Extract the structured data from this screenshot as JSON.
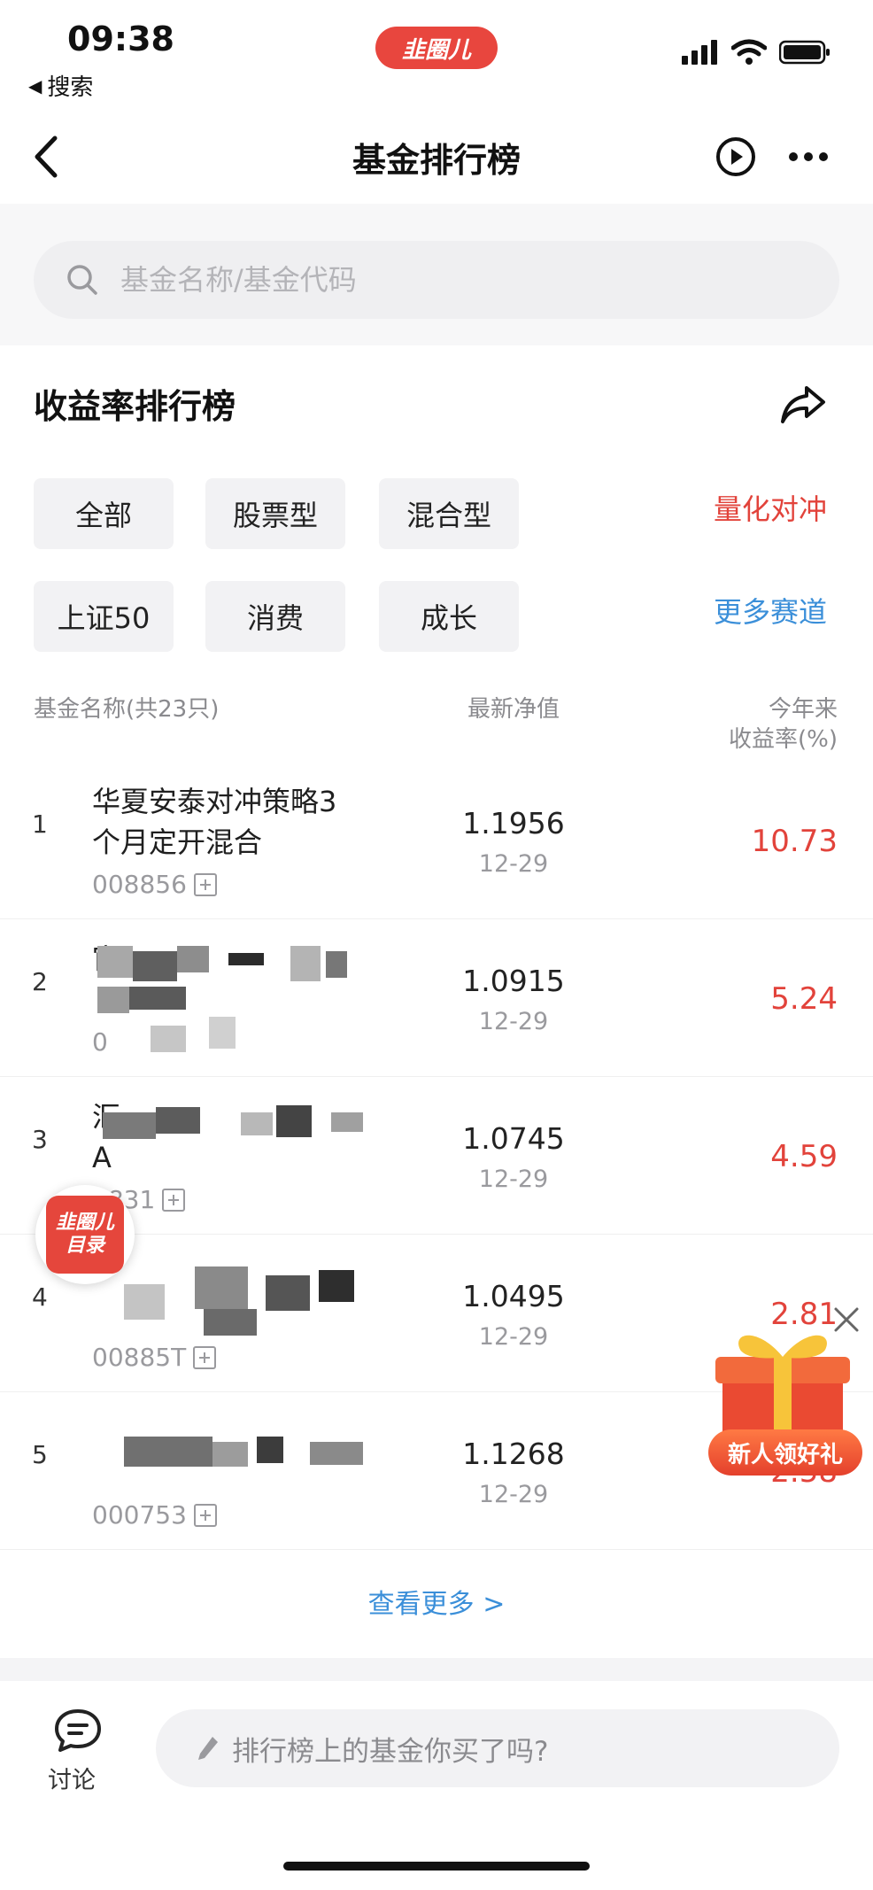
{
  "status_bar": {
    "time": "09:38",
    "back_label": "搜索",
    "brand": "韭圈儿"
  },
  "nav": {
    "title": "基金排行榜"
  },
  "search": {
    "placeholder": "基金名称/基金代码"
  },
  "section": {
    "title": "收益率排行榜"
  },
  "filters": {
    "row1": [
      "全部",
      "股票型",
      "混合型"
    ],
    "row1_link": "量化对冲",
    "row2": [
      "上证50",
      "消费",
      "成长"
    ],
    "row2_link": "更多赛道",
    "active_link_color": "#e2433b",
    "more_link_color": "#3b8fd9"
  },
  "table": {
    "col_name": "基金名称(共23只)",
    "col_nav": "最新净值",
    "col_return_line1": "今年来",
    "col_return_line2": "收益率(%)",
    "rows": [
      {
        "rank": "1",
        "name_line1": "华夏安泰对冲策略3",
        "name_line2": "个月定开混合",
        "code": "008856",
        "nav": "1.1956",
        "date": "12-29",
        "ret": "10.73"
      },
      {
        "rank": "2",
        "name_line1": "宦",
        "name_line2": "",
        "code": "0",
        "nav": "1.0915",
        "date": "12-29",
        "ret": "5.24"
      },
      {
        "rank": "3",
        "name_line1": "汇",
        "name_line2": "A",
        "code": "3831",
        "nav": "1.0745",
        "date": "12-29",
        "ret": "4.59"
      },
      {
        "rank": "4",
        "name_line1": "",
        "name_line2": "",
        "code": "00885T",
        "nav": "1.0495",
        "date": "12-29",
        "ret": "2.81"
      },
      {
        "rank": "5",
        "name_line1": "",
        "name_line2": "",
        "code": "000753",
        "nav": "1.1268",
        "date": "12-29",
        "ret": "2.58"
      }
    ]
  },
  "see_more": "查看更多 >",
  "bottom_bar": {
    "discuss_label": "讨论",
    "comment_placeholder": "排行榜上的基金你买了吗?"
  },
  "floating": {
    "badge_line1": "韭圈儿",
    "badge_line2": "目录",
    "gift_label": "新人领好礼"
  }
}
